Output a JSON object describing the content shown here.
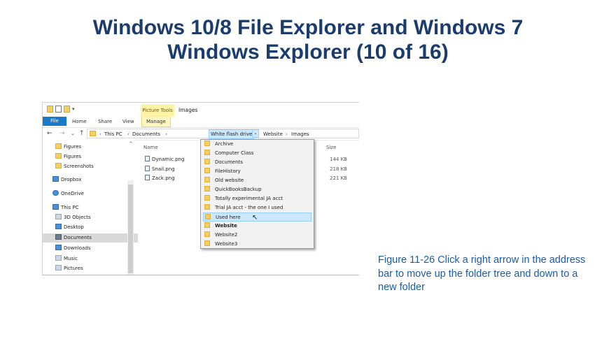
{
  "slide": {
    "title_line1": "Windows 10/8 File Explorer and Windows 7",
    "title_line2": "Windows Explorer (10 of 16)",
    "caption": "Figure 11-26  Click a right arrow in the address bar to move up the folder tree and down to a new folder"
  },
  "window": {
    "quick_access_dropdown": "▾",
    "contextual_tab": "Picture Tools",
    "title": "Images"
  },
  "ribbon": {
    "tabs": [
      "File",
      "Home",
      "Share",
      "View",
      "Manage"
    ]
  },
  "address_bar": {
    "back_icon": "←",
    "forward_icon": "→",
    "recent_icon": "⌄",
    "up_icon": "↑",
    "crumbs": [
      "This PC",
      "Documents",
      "White flash drive",
      "Website",
      "Images"
    ],
    "separator": "›",
    "dropdown_arrow": "⌄"
  },
  "nav_pane": {
    "up_caret": "^",
    "items": [
      {
        "label": "Figures",
        "icon": "folder-icon"
      },
      {
        "label": "Figures",
        "icon": "folder-icon"
      },
      {
        "label": "Screenshots",
        "icon": "folder-icon"
      },
      {
        "label": "Dropbox",
        "icon": "dropbox-icon"
      },
      {
        "label": "OneDrive",
        "icon": "onedrive-icon"
      },
      {
        "label": "This PC",
        "icon": "computer-icon"
      },
      {
        "label": "3D Objects",
        "icon": "3d-objects-icon"
      },
      {
        "label": "Desktop",
        "icon": "desktop-icon"
      },
      {
        "label": "Documents",
        "icon": "documents-icon"
      },
      {
        "label": "Downloads",
        "icon": "downloads-icon"
      },
      {
        "label": "Music",
        "icon": "music-icon"
      },
      {
        "label": "Pictures",
        "icon": "pictures-icon"
      }
    ],
    "selected": "Documents"
  },
  "file_list": {
    "headers": {
      "name": "Name",
      "size": "Size"
    },
    "files": [
      {
        "name": "Dynamic.png",
        "size": "144 KB"
      },
      {
        "name": "Snail.png",
        "size": "218 KB"
      },
      {
        "name": "Zack.png",
        "size": "221 KB"
      }
    ]
  },
  "dropdown": {
    "items": [
      "Archive",
      "Computer Class",
      "Documents",
      "FileHistory",
      "Old website",
      "QuickBooksBackup",
      "Totally experimental JA acct",
      "Trial JA acct - the one I used",
      "Used here",
      "Website",
      "Website2",
      "Website3"
    ],
    "selected_index": 8,
    "bold_index": 9,
    "cursor_icon": "↖"
  },
  "colors": {
    "title": "#1b3c6e",
    "caption": "#1d5a9e",
    "file_tab": "#1979ca",
    "picture_tools": "#fdf3a4",
    "selection": "#cce8ff"
  }
}
